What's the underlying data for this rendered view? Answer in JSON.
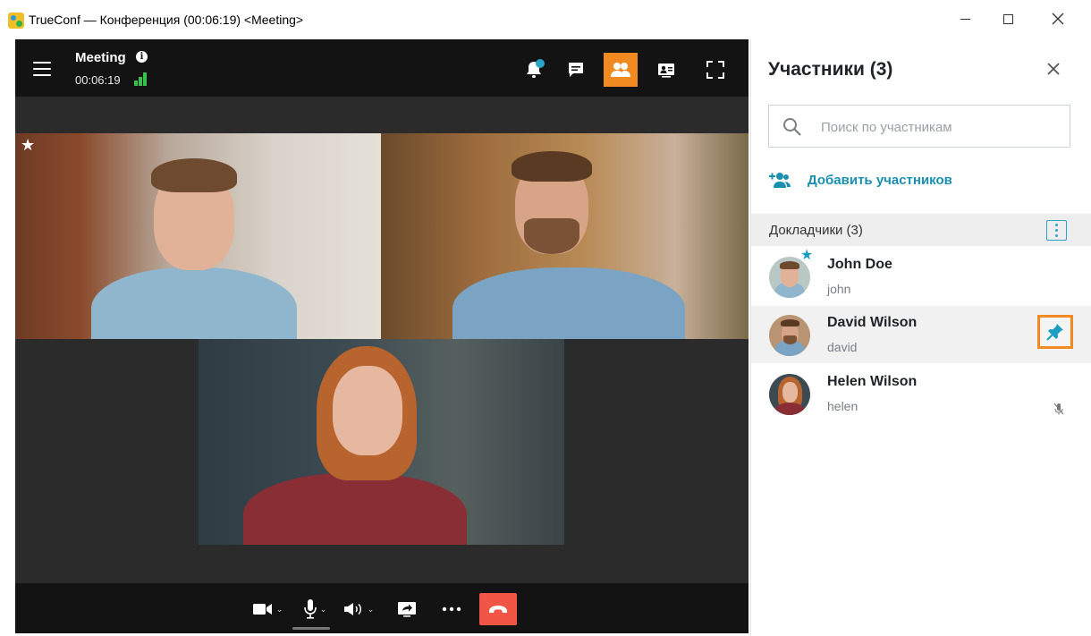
{
  "window": {
    "title": "TrueConf — Конференция (00:06:19) <Meeting>",
    "controls": [
      "minimize-icon",
      "maximize-icon",
      "close-icon"
    ]
  },
  "conference": {
    "title": "Meeting",
    "timer": "00:06:19",
    "toolbar_icons": [
      "bell-icon",
      "chat-icon",
      "participants-icon",
      "layout-icon",
      "fullscreen-icon"
    ],
    "active_toolbar_button": "participants",
    "accent_color": "#f28a22",
    "signal_color": "#36c24a"
  },
  "videos": [
    {
      "name": "John Doe",
      "pinned_star": true
    },
    {
      "name": "David Wilson"
    },
    {
      "name": "Helen Wilson"
    }
  ],
  "controls_bar": {
    "icons": [
      "camera-icon",
      "microphone-icon",
      "speaker-icon",
      "screen-share-icon",
      "more-icon",
      "hangup-icon"
    ],
    "hangup_color": "#f05545"
  },
  "panel": {
    "title": "Участники (3)",
    "search_placeholder": "Поиск по участникам",
    "add_label": "Добавить участников",
    "section_label": "Докладчики (3)",
    "link_color": "#1a8fb0",
    "participants": [
      {
        "name": "John Doe",
        "login": "john",
        "moderator_star": true,
        "highlighted": false
      },
      {
        "name": "David Wilson",
        "login": "david",
        "moderator_star": false,
        "highlighted": true,
        "pin_button": true
      },
      {
        "name": "Helen Wilson",
        "login": "helen",
        "moderator_star": false,
        "highlighted": false,
        "mic_muted": true
      }
    ]
  }
}
